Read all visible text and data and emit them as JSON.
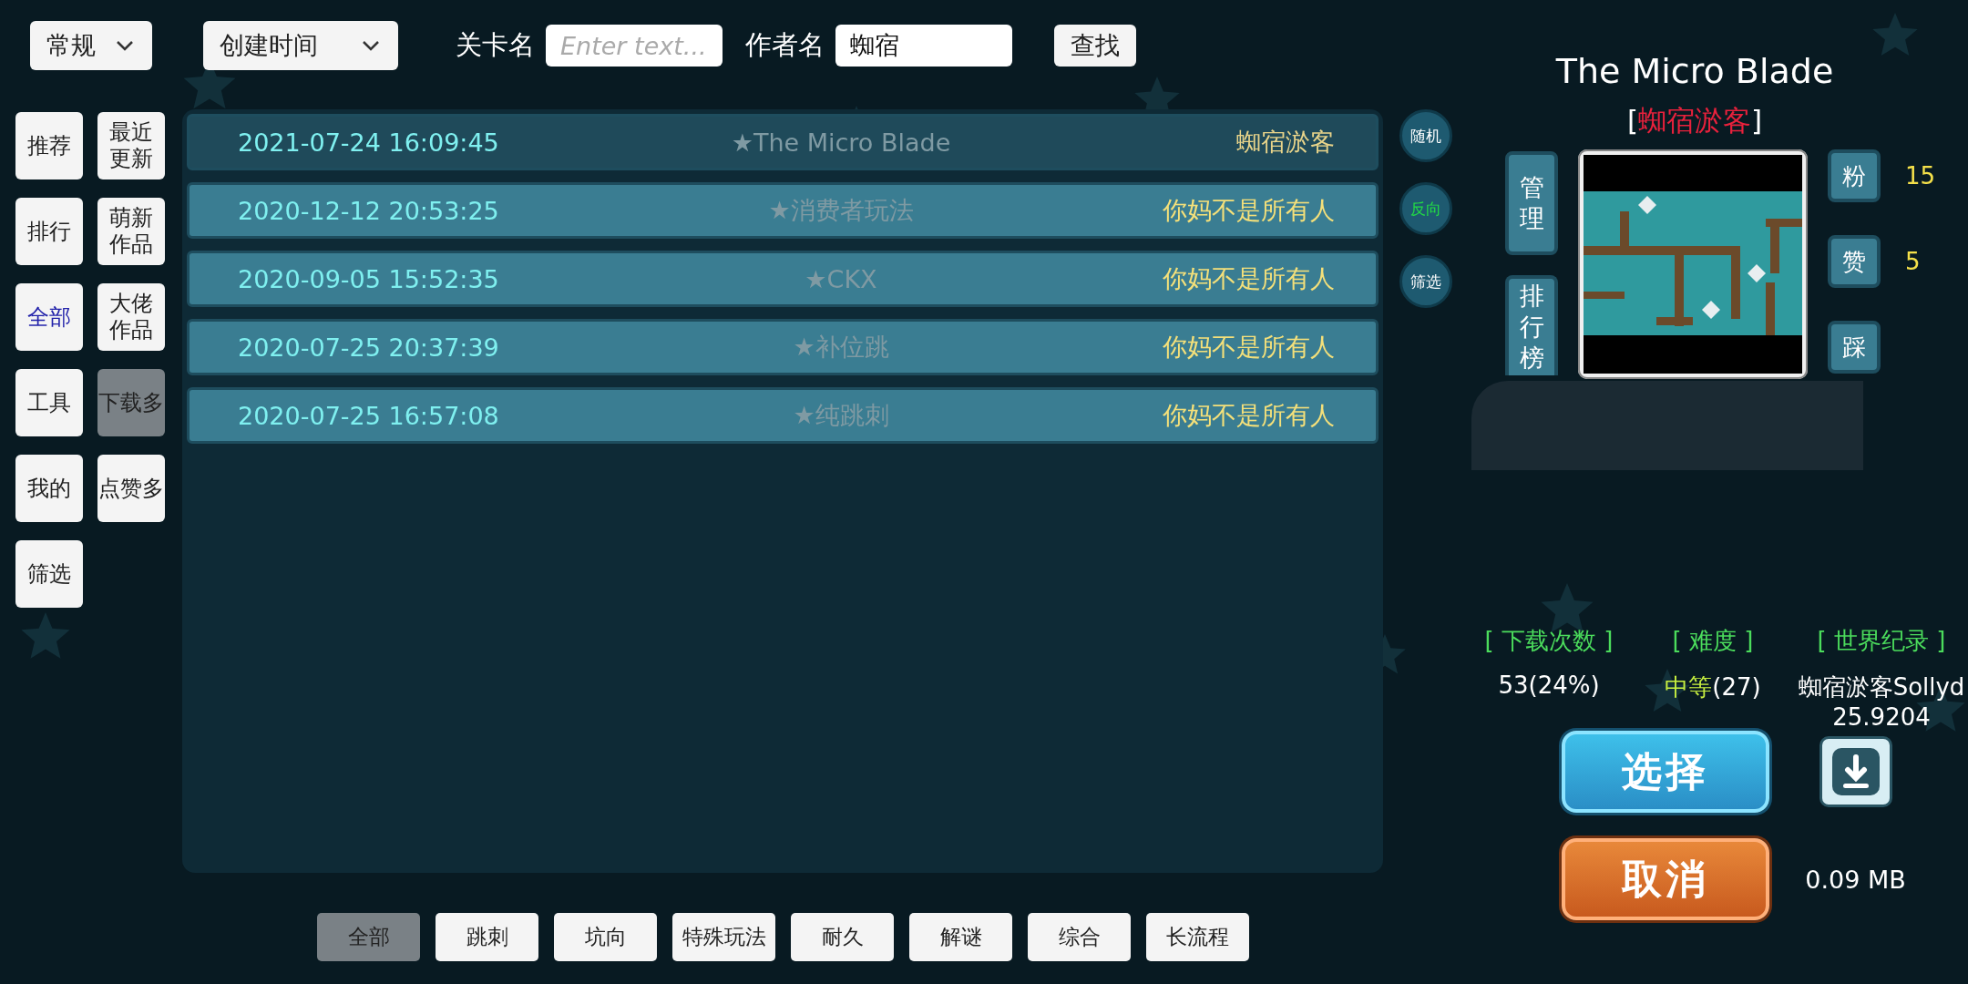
{
  "filters": {
    "category": {
      "value": "常规"
    },
    "sort": {
      "value": "创建时间"
    },
    "level_name": {
      "label": "关卡名",
      "placeholder": "Enter text..."
    },
    "author": {
      "label": "作者名",
      "value": "蜘宿"
    },
    "search_button": "查找"
  },
  "sidebar": [
    {
      "label": "推荐",
      "selected": false,
      "active": false
    },
    {
      "label": "排行",
      "selected": false,
      "active": false
    },
    {
      "label": "全部",
      "selected": true,
      "active": false
    },
    {
      "label": "工具",
      "selected": false,
      "active": false
    },
    {
      "label": "我的",
      "selected": false,
      "active": false
    },
    {
      "label": "筛选",
      "selected": false,
      "active": false
    },
    {
      "label": "最近更新",
      "selected": false,
      "active": false
    },
    {
      "label": "萌新作品",
      "selected": false,
      "active": false
    },
    {
      "label": "大佬作品",
      "selected": false,
      "active": false
    },
    {
      "label": "下载多",
      "selected": false,
      "active": true
    },
    {
      "label": "点赞多",
      "selected": false,
      "active": false
    }
  ],
  "levels": [
    {
      "created": "2021-07-24 16:09:45",
      "title": "★The Micro Blade",
      "author": "蜘宿淤客",
      "selected": true
    },
    {
      "created": "2020-12-12 20:53:25",
      "title": "★消费者玩法",
      "author": "你妈不是所有人",
      "selected": false
    },
    {
      "created": "2020-09-05 15:52:35",
      "title": "★CKX",
      "author": "你妈不是所有人",
      "selected": false
    },
    {
      "created": "2020-07-25 20:37:39",
      "title": "★补位跳",
      "author": "你妈不是所有人",
      "selected": false
    },
    {
      "created": "2020-07-25 16:57:08",
      "title": "★纯跳刺",
      "author": "你妈不是所有人",
      "selected": false
    }
  ],
  "side_buttons": [
    {
      "label": "随机",
      "on": false
    },
    {
      "label": "反向",
      "on": true
    },
    {
      "label": "筛选",
      "on": false
    }
  ],
  "category_tabs": [
    {
      "label": "全部",
      "selected": true
    },
    {
      "label": "跳刺",
      "selected": false
    },
    {
      "label": "坑向",
      "selected": false
    },
    {
      "label": "特殊玩法",
      "selected": false
    },
    {
      "label": "耐久",
      "selected": false
    },
    {
      "label": "解谜",
      "selected": false
    },
    {
      "label": "综合",
      "selected": false
    },
    {
      "label": "长流程",
      "selected": false
    }
  ],
  "detail": {
    "title": "The Micro Blade",
    "author": {
      "open": "[",
      "name": "蜘宿淤客",
      "close": "]"
    },
    "left_buttons": [
      "管理",
      "排行榜"
    ],
    "preview": {
      "kind": "picture"
    },
    "ratings": [
      {
        "label": "粉",
        "count": "15"
      },
      {
        "label": "赞",
        "count": "5"
      },
      {
        "label": "踩"
      }
    ],
    "stats": [
      {
        "label": "[ 下载次数 ]",
        "kind": "plain",
        "value": "53(24%)"
      },
      {
        "label": "[ 难度 ]",
        "kind": "difficulty",
        "grade": "中等",
        "value": "(27)"
      },
      {
        "label": "[ 世界纪录 ]",
        "kind": "record",
        "holder": "蜘宿淤客Sollyd",
        "value": "25.9204"
      }
    ],
    "select_button": "选择",
    "cancel_button": "取消",
    "file_size": "0.09 MB"
  }
}
